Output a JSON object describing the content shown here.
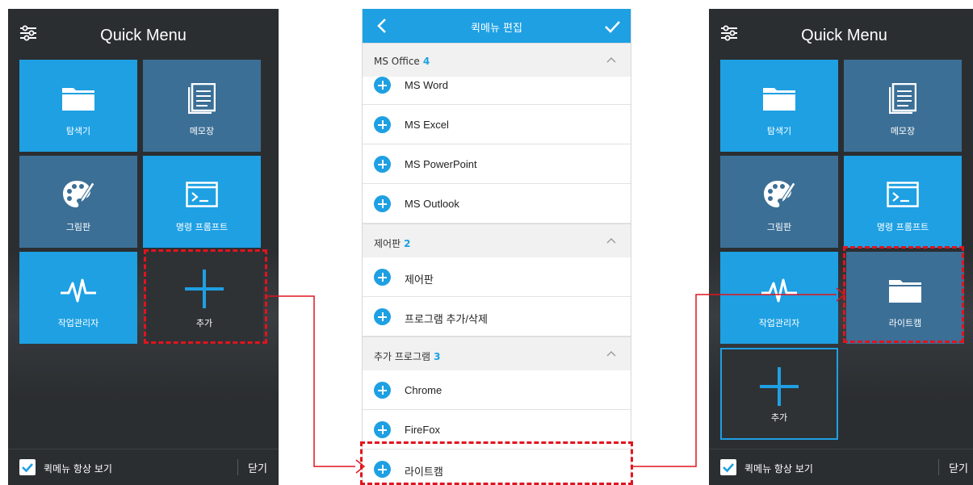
{
  "left_panel": {
    "title": "Quick Menu",
    "tiles": [
      {
        "label": "탐색기",
        "icon": "folder-icon"
      },
      {
        "label": "메모장",
        "icon": "notepad-icon"
      },
      {
        "label": "그림판",
        "icon": "palette-icon"
      },
      {
        "label": "명령 프롬프트",
        "icon": "command-prompt-icon"
      },
      {
        "label": "작업관리자",
        "icon": "pulse-icon"
      },
      {
        "label": "추가",
        "icon": "plus-icon"
      }
    ],
    "footer": {
      "checkbox_label": "퀵메뉴 항상 보기",
      "close_label": "닫기"
    }
  },
  "middle_panel": {
    "title": "퀵메뉴 편집",
    "sections": [
      {
        "name": "MS Office",
        "count": "4",
        "items": [
          "MS Word",
          "MS Excel",
          "MS PowerPoint",
          "MS Outlook"
        ]
      },
      {
        "name": "제어판",
        "count": "2",
        "items": [
          "제어판",
          "프로그램 추가/삭제"
        ]
      },
      {
        "name": "추가 프로그램",
        "count": "3",
        "items": [
          "Chrome",
          "FireFox",
          "라이트캠"
        ]
      }
    ]
  },
  "right_panel": {
    "title": "Quick Menu",
    "tiles": [
      {
        "label": "탐색기",
        "icon": "folder-icon"
      },
      {
        "label": "메모장",
        "icon": "notepad-icon"
      },
      {
        "label": "그림판",
        "icon": "palette-icon"
      },
      {
        "label": "명령 프롬프트",
        "icon": "command-prompt-icon"
      },
      {
        "label": "작업관리자",
        "icon": "pulse-icon"
      },
      {
        "label": "라이트캠",
        "icon": "folder-icon"
      },
      {
        "label": "추가",
        "icon": "plus-icon"
      }
    ],
    "footer": {
      "checkbox_label": "퀵메뉴 항상 보기",
      "close_label": "닫기"
    }
  },
  "colors": {
    "accent": "#1ea0e3",
    "slate": "#3b6f96",
    "panel_bg": "#2b2e31",
    "highlight": "#e0141e"
  }
}
